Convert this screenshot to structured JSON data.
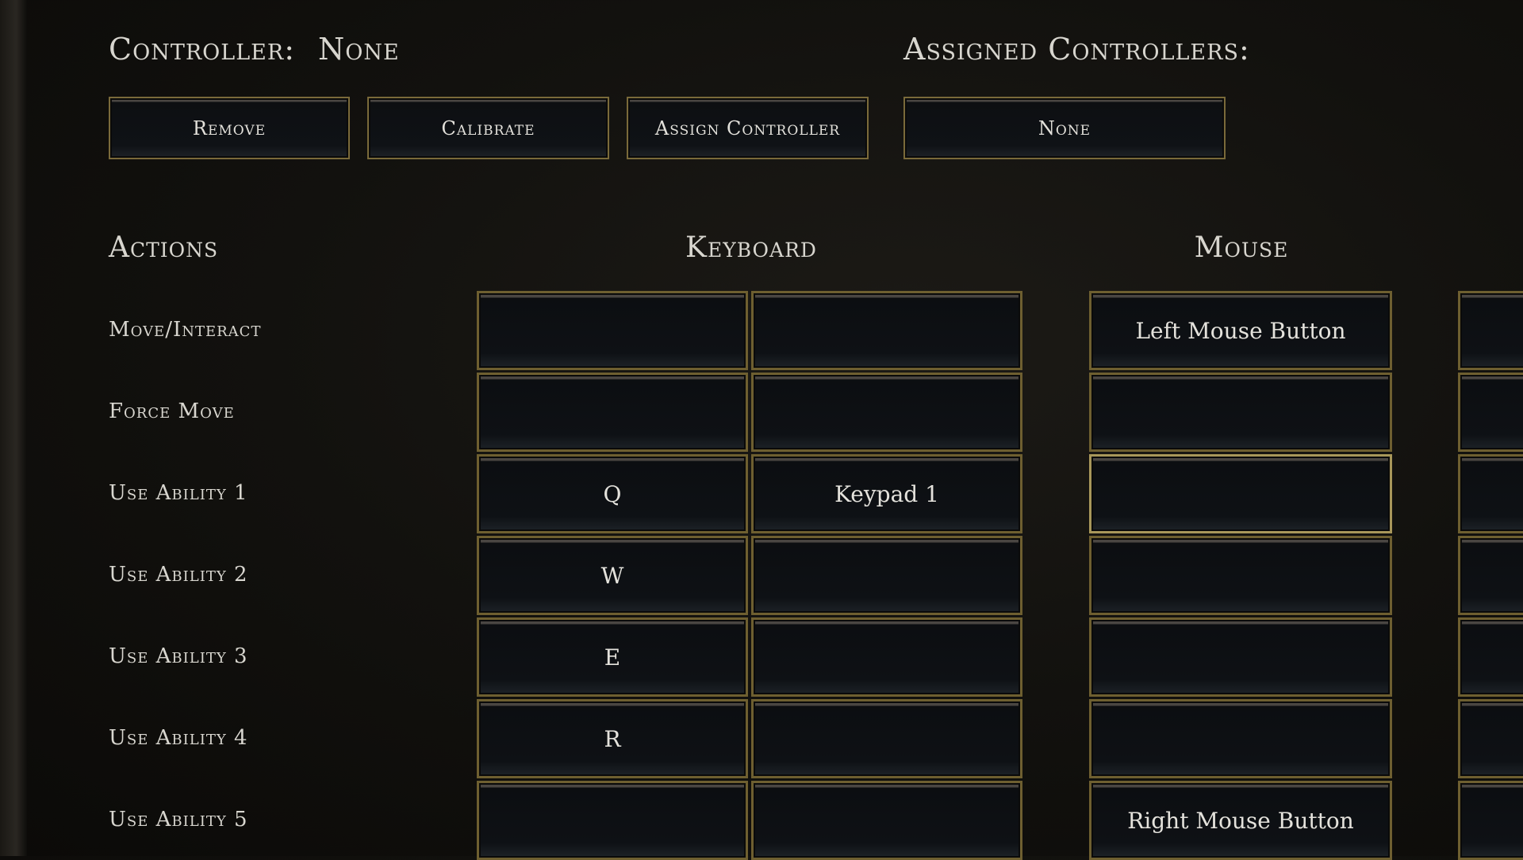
{
  "header": {
    "controller_label": "Controller:",
    "controller_value": "None",
    "assigned_label": "Assigned Controllers:"
  },
  "buttons": {
    "remove": "Remove",
    "calibrate": "Calibrate",
    "assign": "Assign Controller",
    "assigned_value": "None"
  },
  "columns": {
    "actions": "Actions",
    "keyboard": "Keyboard",
    "mouse": "Mouse"
  },
  "rows": [
    {
      "action": "Move/Interact",
      "key1": "",
      "key2": "",
      "mouse": "Left Mouse Button"
    },
    {
      "action": "Force Move",
      "key1": "",
      "key2": "",
      "mouse": ""
    },
    {
      "action": "Use Ability 1",
      "key1": "Q",
      "key2": "Keypad 1",
      "mouse": "",
      "selected_mouse": true
    },
    {
      "action": "Use Ability 2",
      "key1": "W",
      "key2": "",
      "mouse": ""
    },
    {
      "action": "Use Ability 3",
      "key1": "E",
      "key2": "",
      "mouse": ""
    },
    {
      "action": "Use Ability 4",
      "key1": "R",
      "key2": "",
      "mouse": ""
    },
    {
      "action": "Use Ability 5",
      "key1": "",
      "key2": "",
      "mouse": "Right Mouse Button"
    }
  ]
}
